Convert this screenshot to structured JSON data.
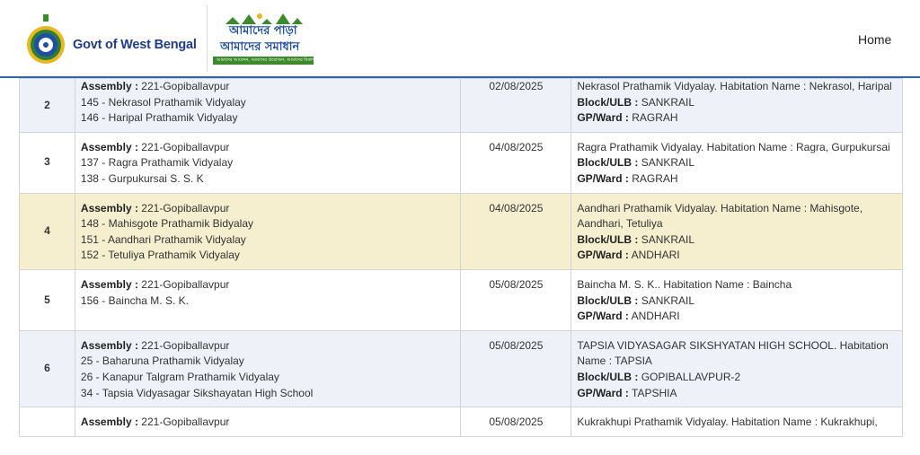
{
  "header": {
    "gov_text": "Govt of West Bengal",
    "brand_line1": "আমাদের পাড়া",
    "brand_line2": "আমাদের সমাধান",
    "brand_tagline": "আমাদের আবেদন, আমাদের প্রয়োজন, আমাদের বিকাশ",
    "nav_home": "Home"
  },
  "labels": {
    "assembly": "Assembly :",
    "block": "Block/ULB :",
    "gp": "GP/Ward :"
  },
  "rows": [
    {
      "num": "2",
      "assembly": "221-Gopiballavpur",
      "venues": [
        "145 - Nekrasol Prathamik Vidyalay",
        "146 - Haripal Prathamik Vidyalay"
      ],
      "date": "02/08/2025",
      "habitation": "Nekrasol Prathamik Vidyalay. Habitation Name : Nekrasol, Haripal",
      "block": "SANKRAIL",
      "gp": "RAGRAH"
    },
    {
      "num": "3",
      "assembly": "221-Gopiballavpur",
      "venues": [
        "137 - Ragra Prathamik Vidyalay",
        "138 - Gurpukursai S. S. K"
      ],
      "date": "04/08/2025",
      "habitation": "Ragra Prathamik Vidyalay. Habitation Name : Ragra, Gurpukursai",
      "block": "SANKRAIL",
      "gp": "RAGRAH"
    },
    {
      "num": "4",
      "assembly": "221-Gopiballavpur",
      "venues": [
        "148 - Mahisgote Prathamik Bidyalay",
        "151 - Aandhari Prathamik Vidyalay",
        "152 - Tetuliya Prathamik Vidyalay"
      ],
      "date": "04/08/2025",
      "habitation": "Aandhari Prathamik Vidyalay. Habitation Name : Mahisgote, Aandhari, Tetuliya",
      "block": "SANKRAIL",
      "gp": "ANDHARI"
    },
    {
      "num": "5",
      "assembly": "221-Gopiballavpur",
      "venues": [
        "156 - Baincha M. S. K."
      ],
      "date": "05/08/2025",
      "habitation": "Baincha M. S. K.. Habitation Name : Baincha",
      "block": "SANKRAIL",
      "gp": "ANDHARI"
    },
    {
      "num": "6",
      "assembly": "221-Gopiballavpur",
      "venues": [
        "25 - Baharuna Prathamik Vidyalay",
        "26 - Kanapur Talgram Prathamik Vidyalay",
        "34 - Tapsia Vidyasagar Sikshayatan High School"
      ],
      "date": "05/08/2025",
      "habitation": "TAPSIA VIDYASAGAR SIKSHYATAN HIGH SCHOOL. Habitation Name : TAPSIA",
      "block": "GOPIBALLAVPUR-2",
      "gp": "TAPSHIA"
    },
    {
      "num": "",
      "assembly": "221-Gopiballavpur",
      "venues": [],
      "date": "05/08/2025",
      "habitation": "Kukrakhupi Prathamik Vidyalay. Habitation Name : Kukrakhupi,",
      "block": "",
      "gp": ""
    }
  ]
}
